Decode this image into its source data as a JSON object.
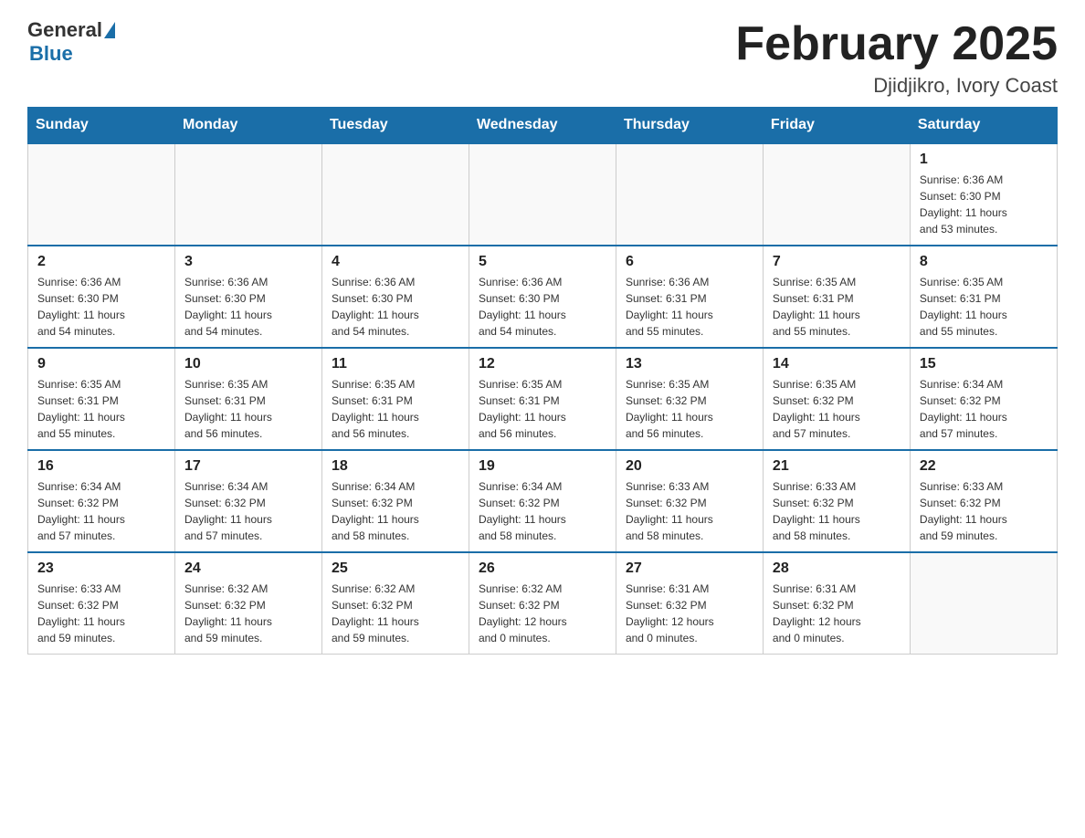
{
  "header": {
    "logo_general": "General",
    "logo_blue": "Blue",
    "title": "February 2025",
    "location": "Djidjikro, Ivory Coast"
  },
  "weekdays": [
    "Sunday",
    "Monday",
    "Tuesday",
    "Wednesday",
    "Thursday",
    "Friday",
    "Saturday"
  ],
  "weeks": [
    [
      {
        "day": "",
        "info": ""
      },
      {
        "day": "",
        "info": ""
      },
      {
        "day": "",
        "info": ""
      },
      {
        "day": "",
        "info": ""
      },
      {
        "day": "",
        "info": ""
      },
      {
        "day": "",
        "info": ""
      },
      {
        "day": "1",
        "info": "Sunrise: 6:36 AM\nSunset: 6:30 PM\nDaylight: 11 hours\nand 53 minutes."
      }
    ],
    [
      {
        "day": "2",
        "info": "Sunrise: 6:36 AM\nSunset: 6:30 PM\nDaylight: 11 hours\nand 54 minutes."
      },
      {
        "day": "3",
        "info": "Sunrise: 6:36 AM\nSunset: 6:30 PM\nDaylight: 11 hours\nand 54 minutes."
      },
      {
        "day": "4",
        "info": "Sunrise: 6:36 AM\nSunset: 6:30 PM\nDaylight: 11 hours\nand 54 minutes."
      },
      {
        "day": "5",
        "info": "Sunrise: 6:36 AM\nSunset: 6:30 PM\nDaylight: 11 hours\nand 54 minutes."
      },
      {
        "day": "6",
        "info": "Sunrise: 6:36 AM\nSunset: 6:31 PM\nDaylight: 11 hours\nand 55 minutes."
      },
      {
        "day": "7",
        "info": "Sunrise: 6:35 AM\nSunset: 6:31 PM\nDaylight: 11 hours\nand 55 minutes."
      },
      {
        "day": "8",
        "info": "Sunrise: 6:35 AM\nSunset: 6:31 PM\nDaylight: 11 hours\nand 55 minutes."
      }
    ],
    [
      {
        "day": "9",
        "info": "Sunrise: 6:35 AM\nSunset: 6:31 PM\nDaylight: 11 hours\nand 55 minutes."
      },
      {
        "day": "10",
        "info": "Sunrise: 6:35 AM\nSunset: 6:31 PM\nDaylight: 11 hours\nand 56 minutes."
      },
      {
        "day": "11",
        "info": "Sunrise: 6:35 AM\nSunset: 6:31 PM\nDaylight: 11 hours\nand 56 minutes."
      },
      {
        "day": "12",
        "info": "Sunrise: 6:35 AM\nSunset: 6:31 PM\nDaylight: 11 hours\nand 56 minutes."
      },
      {
        "day": "13",
        "info": "Sunrise: 6:35 AM\nSunset: 6:32 PM\nDaylight: 11 hours\nand 56 minutes."
      },
      {
        "day": "14",
        "info": "Sunrise: 6:35 AM\nSunset: 6:32 PM\nDaylight: 11 hours\nand 57 minutes."
      },
      {
        "day": "15",
        "info": "Sunrise: 6:34 AM\nSunset: 6:32 PM\nDaylight: 11 hours\nand 57 minutes."
      }
    ],
    [
      {
        "day": "16",
        "info": "Sunrise: 6:34 AM\nSunset: 6:32 PM\nDaylight: 11 hours\nand 57 minutes."
      },
      {
        "day": "17",
        "info": "Sunrise: 6:34 AM\nSunset: 6:32 PM\nDaylight: 11 hours\nand 57 minutes."
      },
      {
        "day": "18",
        "info": "Sunrise: 6:34 AM\nSunset: 6:32 PM\nDaylight: 11 hours\nand 58 minutes."
      },
      {
        "day": "19",
        "info": "Sunrise: 6:34 AM\nSunset: 6:32 PM\nDaylight: 11 hours\nand 58 minutes."
      },
      {
        "day": "20",
        "info": "Sunrise: 6:33 AM\nSunset: 6:32 PM\nDaylight: 11 hours\nand 58 minutes."
      },
      {
        "day": "21",
        "info": "Sunrise: 6:33 AM\nSunset: 6:32 PM\nDaylight: 11 hours\nand 58 minutes."
      },
      {
        "day": "22",
        "info": "Sunrise: 6:33 AM\nSunset: 6:32 PM\nDaylight: 11 hours\nand 59 minutes."
      }
    ],
    [
      {
        "day": "23",
        "info": "Sunrise: 6:33 AM\nSunset: 6:32 PM\nDaylight: 11 hours\nand 59 minutes."
      },
      {
        "day": "24",
        "info": "Sunrise: 6:32 AM\nSunset: 6:32 PM\nDaylight: 11 hours\nand 59 minutes."
      },
      {
        "day": "25",
        "info": "Sunrise: 6:32 AM\nSunset: 6:32 PM\nDaylight: 11 hours\nand 59 minutes."
      },
      {
        "day": "26",
        "info": "Sunrise: 6:32 AM\nSunset: 6:32 PM\nDaylight: 12 hours\nand 0 minutes."
      },
      {
        "day": "27",
        "info": "Sunrise: 6:31 AM\nSunset: 6:32 PM\nDaylight: 12 hours\nand 0 minutes."
      },
      {
        "day": "28",
        "info": "Sunrise: 6:31 AM\nSunset: 6:32 PM\nDaylight: 12 hours\nand 0 minutes."
      },
      {
        "day": "",
        "info": ""
      }
    ]
  ]
}
